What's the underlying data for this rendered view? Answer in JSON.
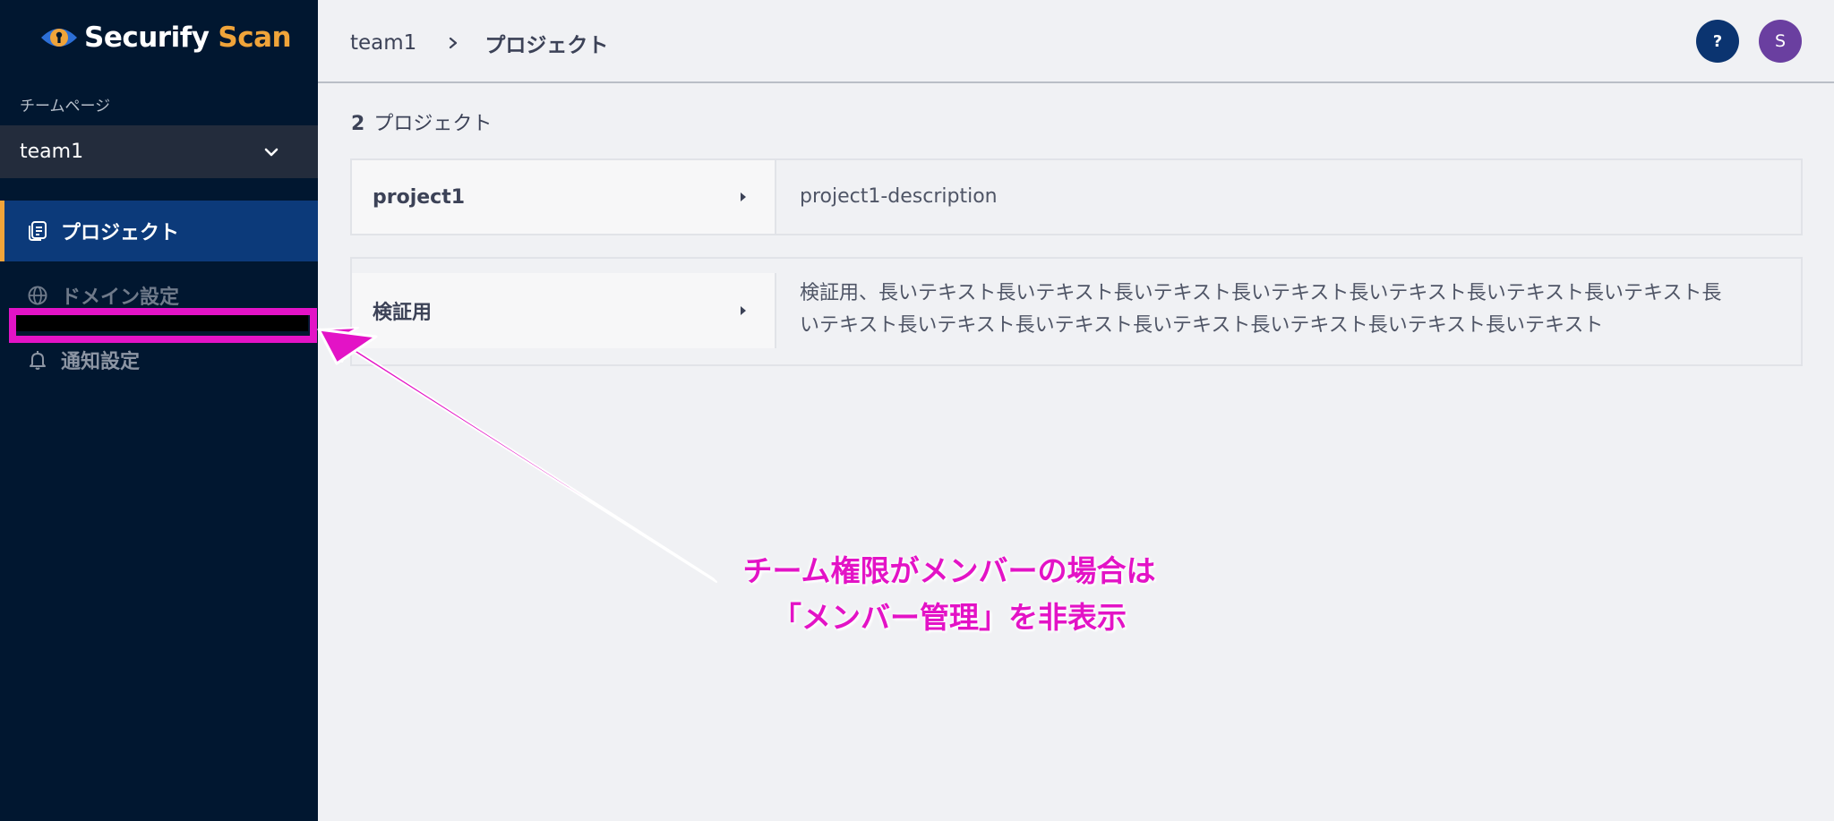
{
  "app": {
    "brand_primary": "Securify",
    "brand_secondary": "Scan",
    "colors": {
      "accent": "#f0a43a",
      "sidebar": "#011730",
      "active_nav": "#0c3a7a",
      "annotation": "#e313c6"
    }
  },
  "sidebar": {
    "team_label": "チームページ",
    "team_select": {
      "value": "team1"
    },
    "items": [
      {
        "label": "プロジェクト",
        "icon": "project-icon",
        "active": true
      },
      {
        "label": "ドメイン設定",
        "icon": "globe-icon",
        "active": false
      },
      {
        "label": "通知設定",
        "icon": "bell-icon",
        "active": false
      }
    ]
  },
  "header": {
    "breadcrumb": [
      "team1",
      "プロジェクト"
    ],
    "help_label": "?",
    "avatar_initial": "S"
  },
  "main": {
    "project_count": "2",
    "project_count_label": "プロジェクト",
    "projects": [
      {
        "name": "project1",
        "description": "project1-description"
      },
      {
        "name": "検証用",
        "description": "検証用、長いテキスト長いテキスト長いテキスト長いテキスト長いテキスト長いテキスト長いテキスト長いテキスト長いテキスト長いテキスト長いテキスト長いテキスト長いテキスト長いテキスト"
      }
    ]
  },
  "annotation": {
    "line1": "チーム権限がメンバーの場合は",
    "line2": "「メンバー管理」を非表示"
  }
}
